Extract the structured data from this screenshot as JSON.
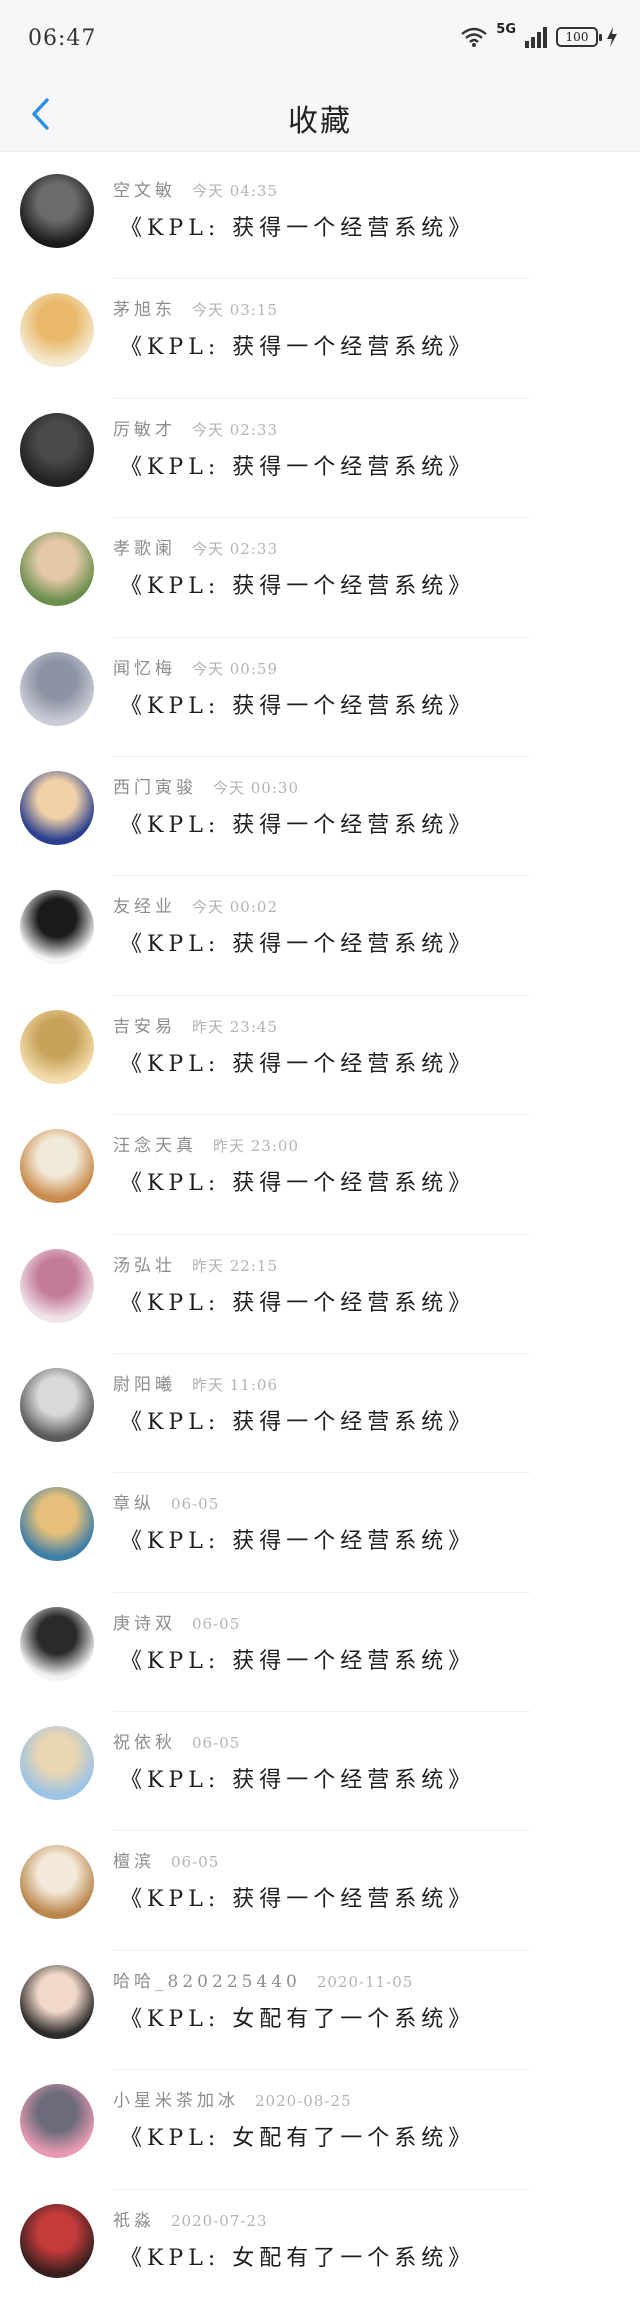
{
  "status": {
    "time": "06:47",
    "network": "5G",
    "battery": "100"
  },
  "header": {
    "title": "收藏"
  },
  "colors": {
    "accent": "#2b8fe6"
  },
  "items": [
    {
      "name": "空文敏",
      "time": "今天 04:35",
      "message": "《KPL: 获得一个经营系统》",
      "avatar_colors": [
        "#1b1b1b",
        "#6b6b6b"
      ]
    },
    {
      "name": "茅旭东",
      "time": "今天 03:15",
      "message": "《KPL: 获得一个经营系统》",
      "avatar_colors": [
        "#f3e9cf",
        "#e9b96a"
      ]
    },
    {
      "name": "厉敏才",
      "time": "今天 02:33",
      "message": "《KPL: 获得一个经营系统》",
      "avatar_colors": [
        "#222222",
        "#4a4a4a"
      ]
    },
    {
      "name": "孝歌阑",
      "time": "今天 02:33",
      "message": "《KPL: 获得一个经营系统》",
      "avatar_colors": [
        "#6b8e4e",
        "#e4c9a8"
      ]
    },
    {
      "name": "闻忆梅",
      "time": "今天 00:59",
      "message": "《KPL: 获得一个经营系统》",
      "avatar_colors": [
        "#c9ccd6",
        "#8d93a3"
      ]
    },
    {
      "name": "西门寅骏",
      "time": "今天 00:30",
      "message": "《KPL: 获得一个经营系统》",
      "avatar_colors": [
        "#2a3f8f",
        "#f1d2a8"
      ]
    },
    {
      "name": "友经业",
      "time": "今天 00:02",
      "message": "《KPL: 获得一个经营系统》",
      "avatar_colors": [
        "#f4f4f4",
        "#1a1a1a"
      ]
    },
    {
      "name": "吉安易",
      "time": "昨天 23:45",
      "message": "《KPL: 获得一个经营系统》",
      "avatar_colors": [
        "#f3dcab",
        "#c7a25a"
      ]
    },
    {
      "name": "汪念天真",
      "time": "昨天 23:00",
      "message": "《KPL: 获得一个经营系统》",
      "avatar_colors": [
        "#c98a4b",
        "#f2ead9"
      ]
    },
    {
      "name": "汤弘壮",
      "time": "昨天 22:15",
      "message": "《KPL: 获得一个经营系统》",
      "avatar_colors": [
        "#f0e4ea",
        "#c47b9a"
      ]
    },
    {
      "name": "尉阳曦",
      "time": "昨天 11:06",
      "message": "《KPL: 获得一个经营系统》",
      "avatar_colors": [
        "#5a5a5a",
        "#d9d9d9"
      ]
    },
    {
      "name": "章纵",
      "time": "06-05",
      "message": "《KPL: 获得一个经营系统》",
      "avatar_colors": [
        "#3e7ea8",
        "#e6c07a"
      ]
    },
    {
      "name": "庚诗双",
      "time": "06-05",
      "message": "《KPL: 获得一个经营系统》",
      "avatar_colors": [
        "#f2f2f2",
        "#2a2a2a"
      ]
    },
    {
      "name": "祝依秋",
      "time": "06-05",
      "message": "《KPL: 获得一个经营系统》",
      "avatar_colors": [
        "#9cc3e6",
        "#e9d6b2"
      ]
    },
    {
      "name": "檀滨",
      "time": "06-05",
      "message": "《KPL: 获得一个经营系统》",
      "avatar_colors": [
        "#b9864c",
        "#f4e9d8"
      ]
    },
    {
      "name": "哈哈_820225440",
      "time": "2020-11-05",
      "message": "《KPL: 女配有了一个系统》",
      "avatar_colors": [
        "#2b2b2b",
        "#f1d8c8"
      ]
    },
    {
      "name": "小星米茶加冰",
      "time": "2020-08-25",
      "message": "《KPL: 女配有了一个系统》",
      "avatar_colors": [
        "#e79ab2",
        "#6b6b7a"
      ]
    },
    {
      "name": "祇淼",
      "time": "2020-07-23",
      "message": "《KPL: 女配有了一个系统》",
      "avatar_colors": [
        "#3a1f1f",
        "#c43b3b"
      ]
    }
  ]
}
